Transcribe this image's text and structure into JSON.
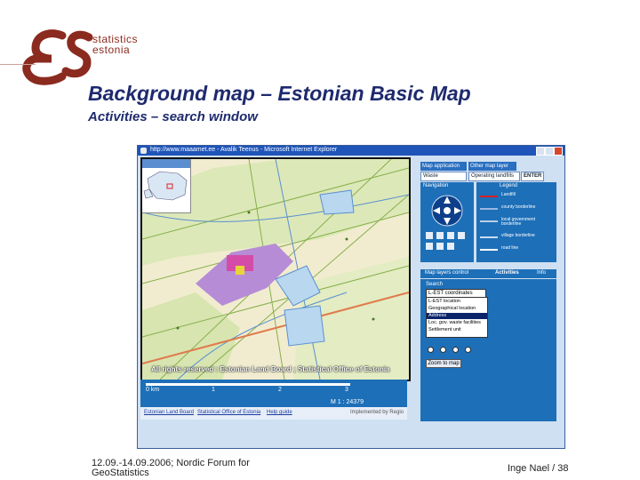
{
  "brand": {
    "line1": "statistics",
    "line2": "estonia",
    "logo_color": "#8b2a1f"
  },
  "slide": {
    "title": "Background map – Estonian Basic Map",
    "subtitle": "Activities – search window",
    "footer_left_line1": "12.09.-14.09.2006; Nordic Forum for",
    "footer_left_line2": "GeoStatistics",
    "footer_right": "Inge Nael / 38",
    "title_color": "#1e2a6e"
  },
  "screenshot": {
    "window_title": "http://www.maaamet.ee - Avalik Teenus - Microsoft Internet Explorer",
    "map_watermark": "All rights reserved : Estonian Land Board ; Statistical Office of Estonia",
    "scale_numbers": [
      "0 km",
      "1",
      "2",
      "3"
    ],
    "scale_text": "M 1 : 24379",
    "links": [
      "Estonian Land Board",
      "Statistical Office of Estonia",
      "Help guide"
    ],
    "links_right": "Implemented by Regio",
    "panel": {
      "map_application_label": "Map application",
      "map_application_value": "Waste",
      "other_layer_label": "Other map layer",
      "other_layer_value": "Operating landfills",
      "enter_label": "ENTER",
      "navigation_title": "Navigation",
      "legend_title": "Legend",
      "legend_items": [
        "Landfill",
        "county borderline",
        "local government borderline",
        "village borderline",
        "road line"
      ],
      "tabs": [
        "Map layers control",
        "Activities",
        "Info"
      ],
      "search_label": "Search",
      "search_value": "L-EST coordinates",
      "dropdown_items": [
        "L-EST location",
        "Geographical location",
        "Address",
        "Loc. gov. waste facilities",
        "Settlement unit"
      ],
      "zoom_button": "Zoom to map"
    }
  }
}
